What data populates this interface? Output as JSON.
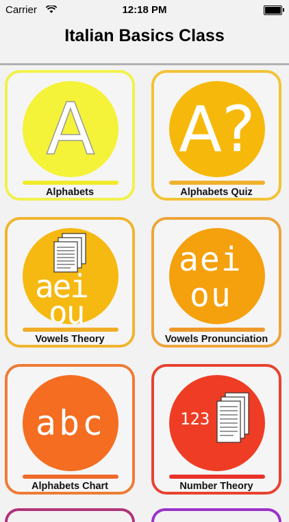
{
  "status_bar": {
    "carrier": "Carrier",
    "time": "12:18 PM"
  },
  "header": {
    "title": "Italian Basics Class"
  },
  "tiles": [
    {
      "label": "Alphabets",
      "icon_text": "A",
      "color": "#f5f23a",
      "border": "#f1f14a"
    },
    {
      "label": "Alphabets Quiz",
      "icon_text": "A?",
      "color": "#f6b90b",
      "border": "#f3c235"
    },
    {
      "label": "Vowels Theory",
      "icon_line1": "aei",
      "icon_line2": "ou",
      "color": "#f6b912",
      "border": "#f0b52e"
    },
    {
      "label": "Vowels Pronunciation",
      "icon_line1": "aei",
      "icon_line2": "ou",
      "color": "#f5a00d",
      "border": "#eea43a"
    },
    {
      "label": "Alphabets Chart",
      "icon_text": "abc",
      "color": "#f46d21",
      "border": "#ee7b35"
    },
    {
      "label": "Number Theory",
      "icon_text": "123",
      "color": "#ee3d24",
      "border": "#e7432f"
    }
  ],
  "partial_tiles": [
    {
      "border": "#b0327a"
    },
    {
      "border": "#9a32c8"
    }
  ]
}
